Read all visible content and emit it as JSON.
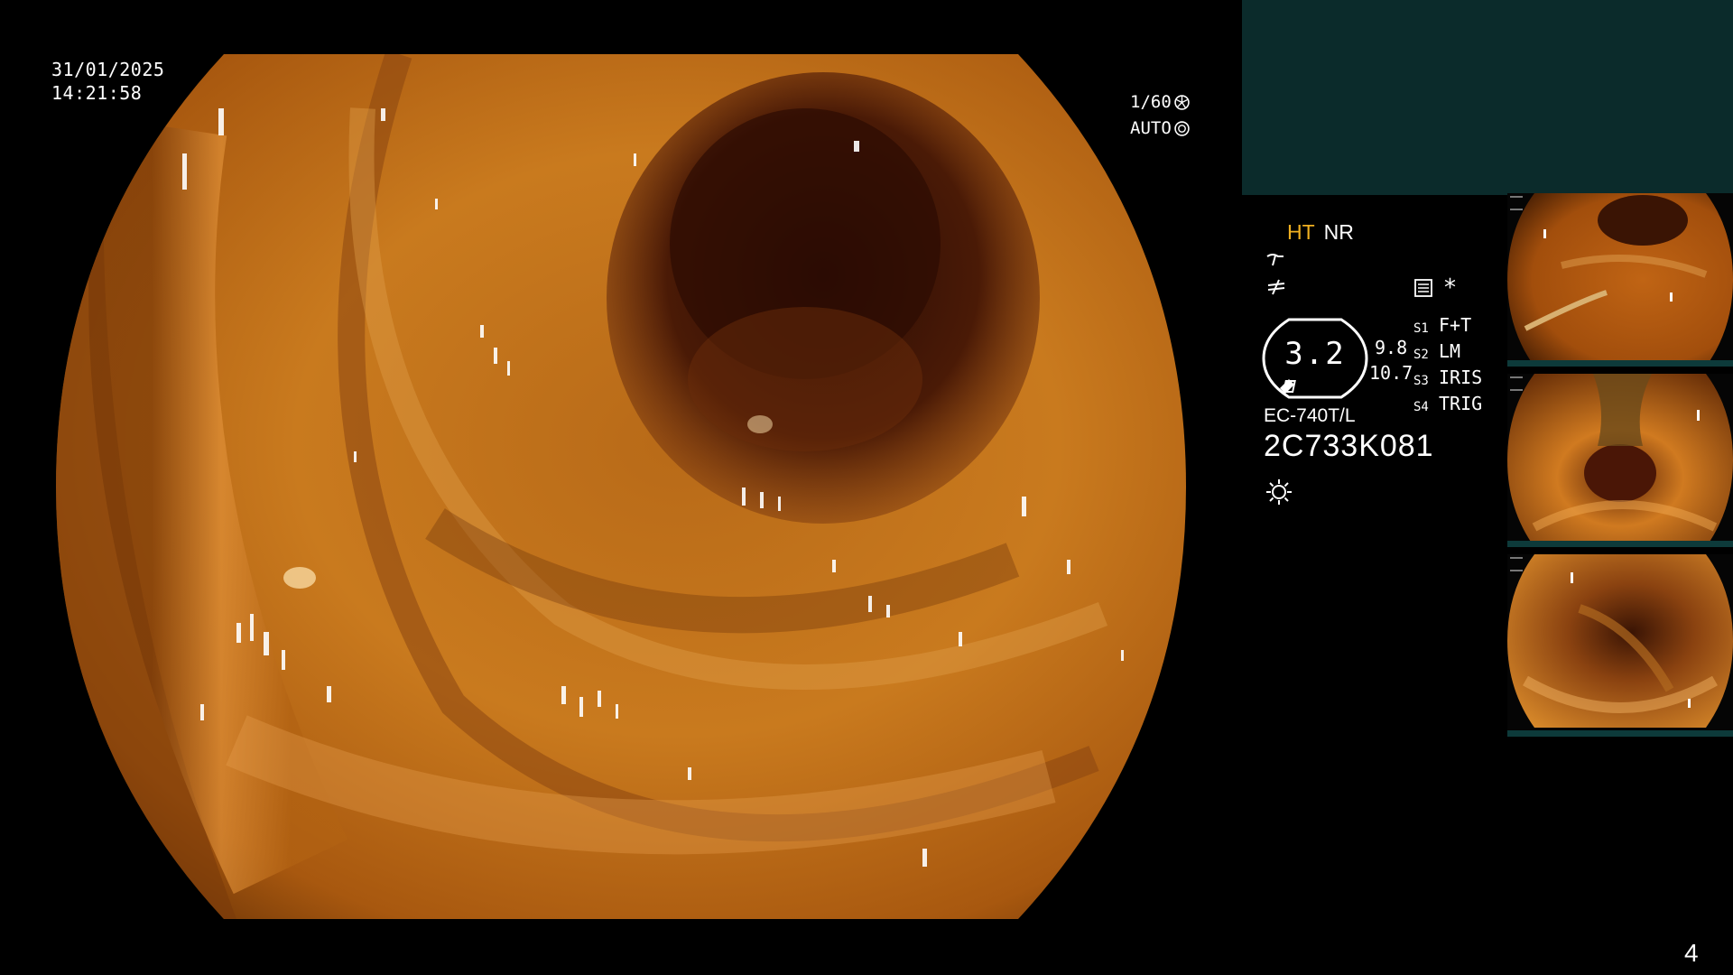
{
  "datetime": {
    "date": "31/01/2025",
    "time": "14:21:58"
  },
  "exposure": {
    "shutter": "1/60",
    "iris_mode": "AUTO"
  },
  "image_modes": {
    "ht": "HT",
    "nr": "NR"
  },
  "enhancement": {
    "level": "3.2",
    "value_a": "9.8",
    "value_b": "10.7"
  },
  "switches": [
    {
      "key": "S1",
      "function": "F+T"
    },
    {
      "key": "S2",
      "function": "LM"
    },
    {
      "key": "S3",
      "function": "IRIS"
    },
    {
      "key": "S4",
      "function": "TRIG"
    }
  ],
  "extra_indicator": "*",
  "scope": {
    "model": "EC-740T/L",
    "serial": "2C733K081"
  },
  "page_number": "4",
  "colors": {
    "ht_label": "#f0b020",
    "panel_teal": "#0b2b2b",
    "mucosa_orange": "#c46a14"
  },
  "icons": [
    "shutter-icon",
    "iris-icon",
    "curve-icon",
    "not-equal-icon",
    "image-settings-icon",
    "light-source-icon"
  ]
}
